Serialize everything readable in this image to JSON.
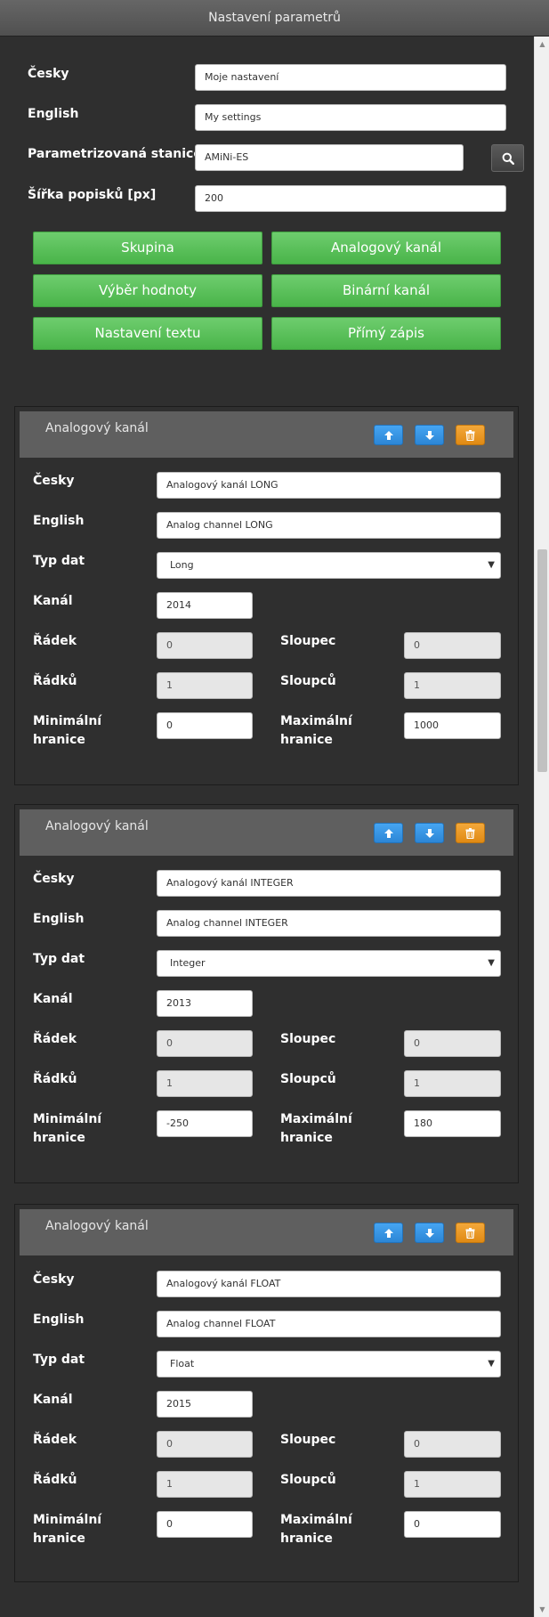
{
  "window": {
    "title": "Nastavení parametrů"
  },
  "settings": {
    "czech_label": "Česky",
    "czech_value": "Moje nastavení",
    "english_label": "English",
    "english_value": "My settings",
    "station_label": "Parametrizovaná stanice",
    "station_value": "AMiNi-ES",
    "width_label": "Šířka popisků [px]",
    "width_value": "200"
  },
  "add_buttons": {
    "group": "Skupina",
    "analog": "Analogový kanál",
    "value_select": "Výběr hodnoty",
    "binary": "Binární kanál",
    "text_setting": "Nastavení textu",
    "direct_write": "Přímý zápis"
  },
  "field_labels": {
    "czech": "Česky",
    "english": "English",
    "data_type": "Typ dat",
    "channel": "Kanál",
    "row": "Řádek",
    "column": "Sloupec",
    "rows": "Řádků",
    "columns": "Sloupců",
    "min_line1": "Minimální",
    "min_line2": "hranice",
    "max_line1": "Maximální",
    "max_line2": "hranice"
  },
  "panels": [
    {
      "title": "Analogový kanál",
      "czech": "Analogový kanál LONG",
      "english": "Analog channel LONG",
      "data_type": "Long",
      "channel": "2014",
      "row": "0",
      "column": "0",
      "rows": "1",
      "columns": "1",
      "min": "0",
      "max": "1000"
    },
    {
      "title": "Analogový kanál",
      "czech": "Analogový kanál INTEGER",
      "english": "Analog channel INTEGER",
      "data_type": "Integer",
      "channel": "2013",
      "row": "0",
      "column": "0",
      "rows": "1",
      "columns": "1",
      "min": "-250",
      "max": "180"
    },
    {
      "title": "Analogový kanál",
      "czech": "Analogový kanál FLOAT",
      "english": "Analog channel FLOAT",
      "data_type": "Float",
      "channel": "2015",
      "row": "0",
      "column": "0",
      "rows": "1",
      "columns": "1",
      "min": "0",
      "max": "0"
    }
  ],
  "icons": {
    "up": "arrow-up-icon",
    "down": "arrow-down-icon",
    "delete": "trash-icon",
    "search": "search-icon",
    "dropdown": "caret-down-icon"
  },
  "colors": {
    "green_button": "#5cbf5c",
    "blue_button": "#3a97e6",
    "orange_button": "#ee9a24",
    "panel_header": "#5f5f5f",
    "background": "#2f2f2f"
  }
}
